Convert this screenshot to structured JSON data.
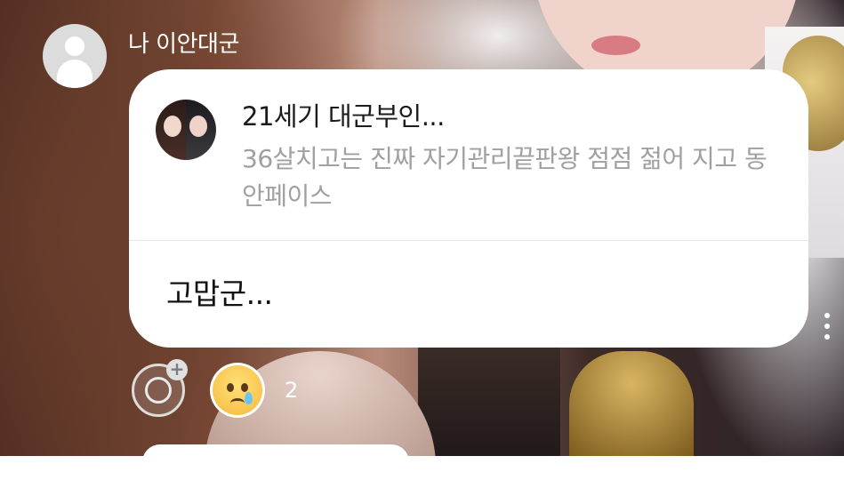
{
  "sender": {
    "name": "나 이안대군",
    "avatar_icon": "default-profile-icon"
  },
  "message": {
    "quoted": {
      "title": "21세기 대군부인...",
      "text": "36살치고는 진짜 자기관리끝판왕 점점 젊어 지고 동안페이스",
      "thumbnail_icon": "couple-thumbnail"
    },
    "reply_text": "고맙군..."
  },
  "reactions": {
    "add_icon": "add-reaction-icon",
    "items": [
      {
        "emoji": "crying-face-emoji",
        "count": "2"
      }
    ]
  },
  "colors": {
    "bubble": "#ffffff",
    "quoted_text": "#a0a0a0",
    "divider": "#e6e6e6"
  }
}
